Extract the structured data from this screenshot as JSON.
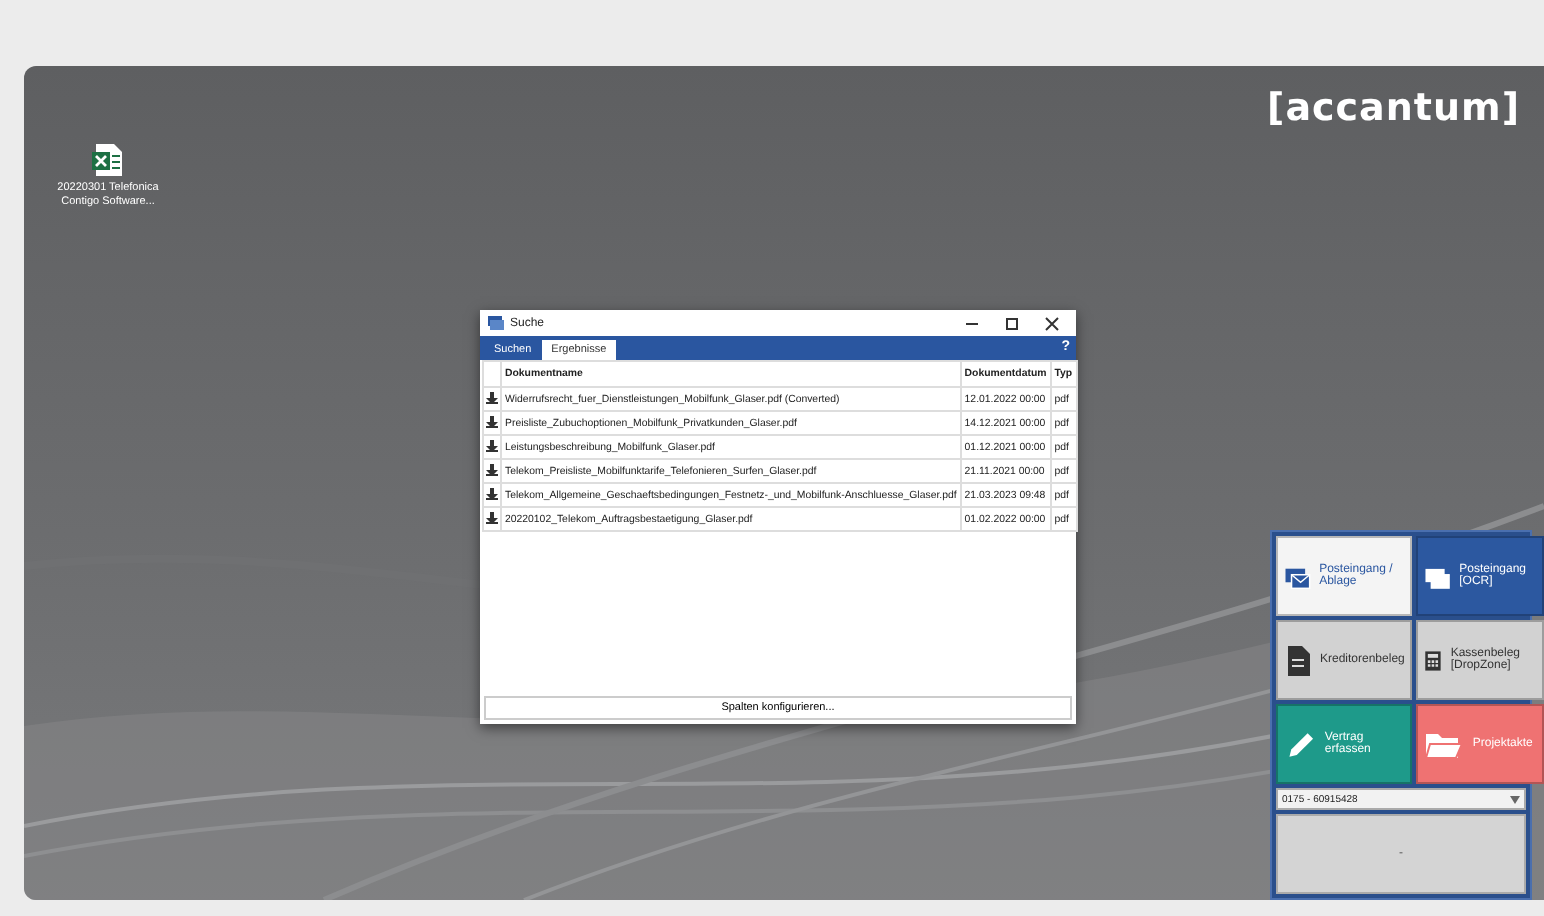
{
  "desktop": {
    "logo": "[accantum]",
    "icons": [
      {
        "label": "20220301 Telefonica Contigo Software..."
      }
    ]
  },
  "dialog": {
    "title": "Suche",
    "tabs": [
      {
        "label": "Suchen",
        "selected": false
      },
      {
        "label": "Ergebnisse",
        "selected": true
      }
    ],
    "help": "?",
    "columns": [
      "Dokumentname",
      "Dokumentdatum",
      "Typ"
    ],
    "rows": [
      {
        "name": "Widerrufsrecht_fuer_Dienstleistungen_Mobilfunk_Glaser.pdf (Converted)",
        "date": "12.01.2022 00:00",
        "type": "pdf"
      },
      {
        "name": "Preisliste_Zubuchoptionen_Mobilfunk_Privatkunden_Glaser.pdf",
        "date": "14.12.2021 00:00",
        "type": "pdf"
      },
      {
        "name": "Leistungsbeschreibung_Mobilfunk_Glaser.pdf",
        "date": "01.12.2021 00:00",
        "type": "pdf"
      },
      {
        "name": "Telekom_Preisliste_Mobilfunktarife_Telefonieren_Surfen_Glaser.pdf",
        "date": "21.11.2021 00:00",
        "type": "pdf"
      },
      {
        "name": "Telekom_Allgemeine_Geschaeftsbedingungen_Festnetz-_und_Mobilfunk-Anschluesse_Glaser.pdf",
        "date": "21.03.2023 09:48",
        "type": "pdf"
      },
      {
        "name": "20220102_Telekom_Auftragsbestaetigung_Glaser.pdf",
        "date": "01.02.2022 00:00",
        "type": "pdf"
      }
    ],
    "footer_button": "Spalten konfigurieren..."
  },
  "panel": {
    "tiles": [
      {
        "label": "Posteingang / Ablage",
        "kind": "mail",
        "color": "#f4f4f4"
      },
      {
        "label": "Posteingang [OCR]",
        "kind": "mail",
        "color": "#2c58a0"
      },
      {
        "label": "Kreditorenbeleg",
        "kind": "document",
        "color": "#d2d2d2"
      },
      {
        "label": "Kassenbeleg [DropZone]",
        "kind": "calculator",
        "color": "#d2d2d2"
      },
      {
        "label": "Vertrag erfassen",
        "kind": "pen",
        "color": "#1e9a8a"
      },
      {
        "label": "Projektakte",
        "kind": "folder",
        "color": "#ef7272"
      }
    ],
    "combo": "0175 - 60915428",
    "bottom_button": "-"
  }
}
